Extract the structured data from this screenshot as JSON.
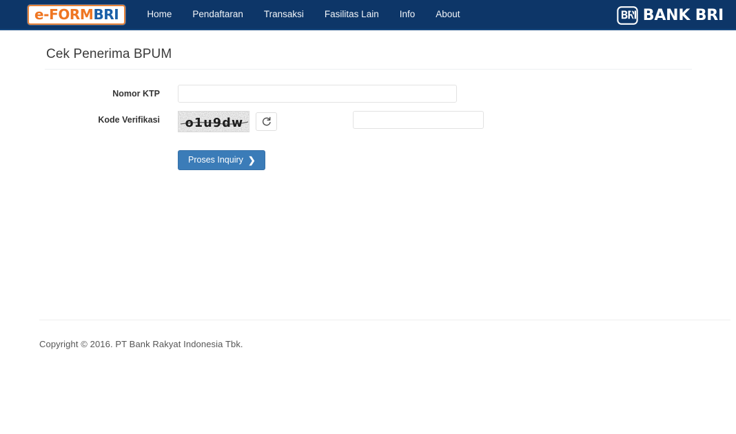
{
  "header": {
    "logo": {
      "part1": "e-FORM",
      "part2": "BRI"
    },
    "nav": [
      {
        "label": "Home"
      },
      {
        "label": "Pendaftaran"
      },
      {
        "label": "Transaksi"
      },
      {
        "label": "Fasilitas Lain"
      },
      {
        "label": "Info"
      },
      {
        "label": "About"
      }
    ],
    "bank_brand": "BANK BRI",
    "bg_color": "#0d3668"
  },
  "main": {
    "page_title": "Cek Penerima BPUM",
    "fields": {
      "ktp": {
        "label": "Nomor KTP",
        "value": "",
        "placeholder": ""
      },
      "captcha": {
        "label": "Kode Verifikasi",
        "image_text": "o1u9dw",
        "refresh_icon": "refresh-icon",
        "value": "",
        "placeholder": ""
      }
    },
    "submit": {
      "label": "Proses Inquiry",
      "icon": "chevron-right-icon",
      "color": "#3b7cb8"
    }
  },
  "footer": {
    "copyright": "Copyright © 2016. PT Bank Rakyat Indonesia Tbk."
  }
}
